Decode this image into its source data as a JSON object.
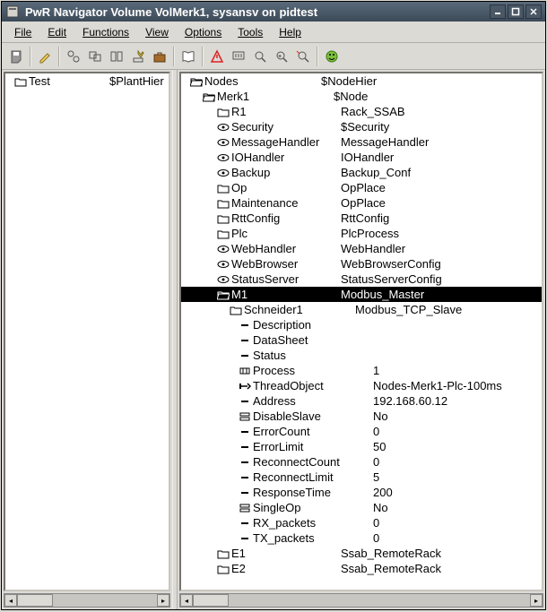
{
  "window": {
    "title": "PwR Navigator Volume VolMerk1, sysansv on pidtest"
  },
  "menu": {
    "file": "File",
    "edit": "Edit",
    "functions": "Functions",
    "view": "View",
    "options": "Options",
    "tools": "Tools",
    "help": "Help"
  },
  "left": {
    "root": {
      "name": "Test",
      "cls": "$PlantHier"
    }
  },
  "right": {
    "root": {
      "name": "Nodes",
      "cls": "$NodeHier"
    },
    "node": {
      "name": "Merk1",
      "cls": "$Node"
    },
    "children": [
      {
        "icon": "map",
        "name": "R1",
        "cls": "Rack_SSAB"
      },
      {
        "icon": "eye",
        "name": "Security",
        "cls": "$Security"
      },
      {
        "icon": "eye",
        "name": "MessageHandler",
        "cls": "MessageHandler"
      },
      {
        "icon": "eye",
        "name": "IOHandler",
        "cls": "IOHandler"
      },
      {
        "icon": "eye",
        "name": "Backup",
        "cls": "Backup_Conf"
      },
      {
        "icon": "map",
        "name": "Op",
        "cls": "OpPlace"
      },
      {
        "icon": "map",
        "name": "Maintenance",
        "cls": "OpPlace"
      },
      {
        "icon": "map",
        "name": "RttConfig",
        "cls": "RttConfig"
      },
      {
        "icon": "map",
        "name": "Plc",
        "cls": "PlcProcess"
      },
      {
        "icon": "eye",
        "name": "WebHandler",
        "cls": "WebHandler"
      },
      {
        "icon": "eye",
        "name": "WebBrowser",
        "cls": "WebBrowserConfig"
      },
      {
        "icon": "eye",
        "name": "StatusServer",
        "cls": "StatusServerConfig"
      },
      {
        "icon": "openmap",
        "name": "M1",
        "cls": "Modbus_Master",
        "selected": true
      }
    ],
    "m1child": {
      "name": "Schneider1",
      "cls": "Modbus_TCP_Slave"
    },
    "attrs": [
      {
        "icon": "dash",
        "name": "Description",
        "val": ""
      },
      {
        "icon": "dash",
        "name": "DataSheet",
        "val": ""
      },
      {
        "icon": "dash",
        "name": "Status",
        "val": ""
      },
      {
        "icon": "proc",
        "name": "Process",
        "val": "1"
      },
      {
        "icon": "ptr",
        "name": "ThreadObject",
        "val": "Nodes-Merk1-Plc-100ms"
      },
      {
        "icon": "dash",
        "name": "Address",
        "val": "192.168.60.12"
      },
      {
        "icon": "stack",
        "name": "DisableSlave",
        "val": "No"
      },
      {
        "icon": "dash",
        "name": "ErrorCount",
        "val": "0"
      },
      {
        "icon": "dash",
        "name": "ErrorLimit",
        "val": "50"
      },
      {
        "icon": "dash",
        "name": "ReconnectCount",
        "val": "0"
      },
      {
        "icon": "dash",
        "name": "ReconnectLimit",
        "val": "5"
      },
      {
        "icon": "dash",
        "name": "ResponseTime",
        "val": "200"
      },
      {
        "icon": "stack",
        "name": "SingleOp",
        "val": "No"
      },
      {
        "icon": "dash",
        "name": "RX_packets",
        "val": "0"
      },
      {
        "icon": "dash",
        "name": "TX_packets",
        "val": "0"
      }
    ],
    "tail": [
      {
        "icon": "map",
        "name": "E1",
        "cls": "Ssab_RemoteRack"
      },
      {
        "icon": "map",
        "name": "E2",
        "cls": "Ssab_RemoteRack"
      }
    ]
  }
}
